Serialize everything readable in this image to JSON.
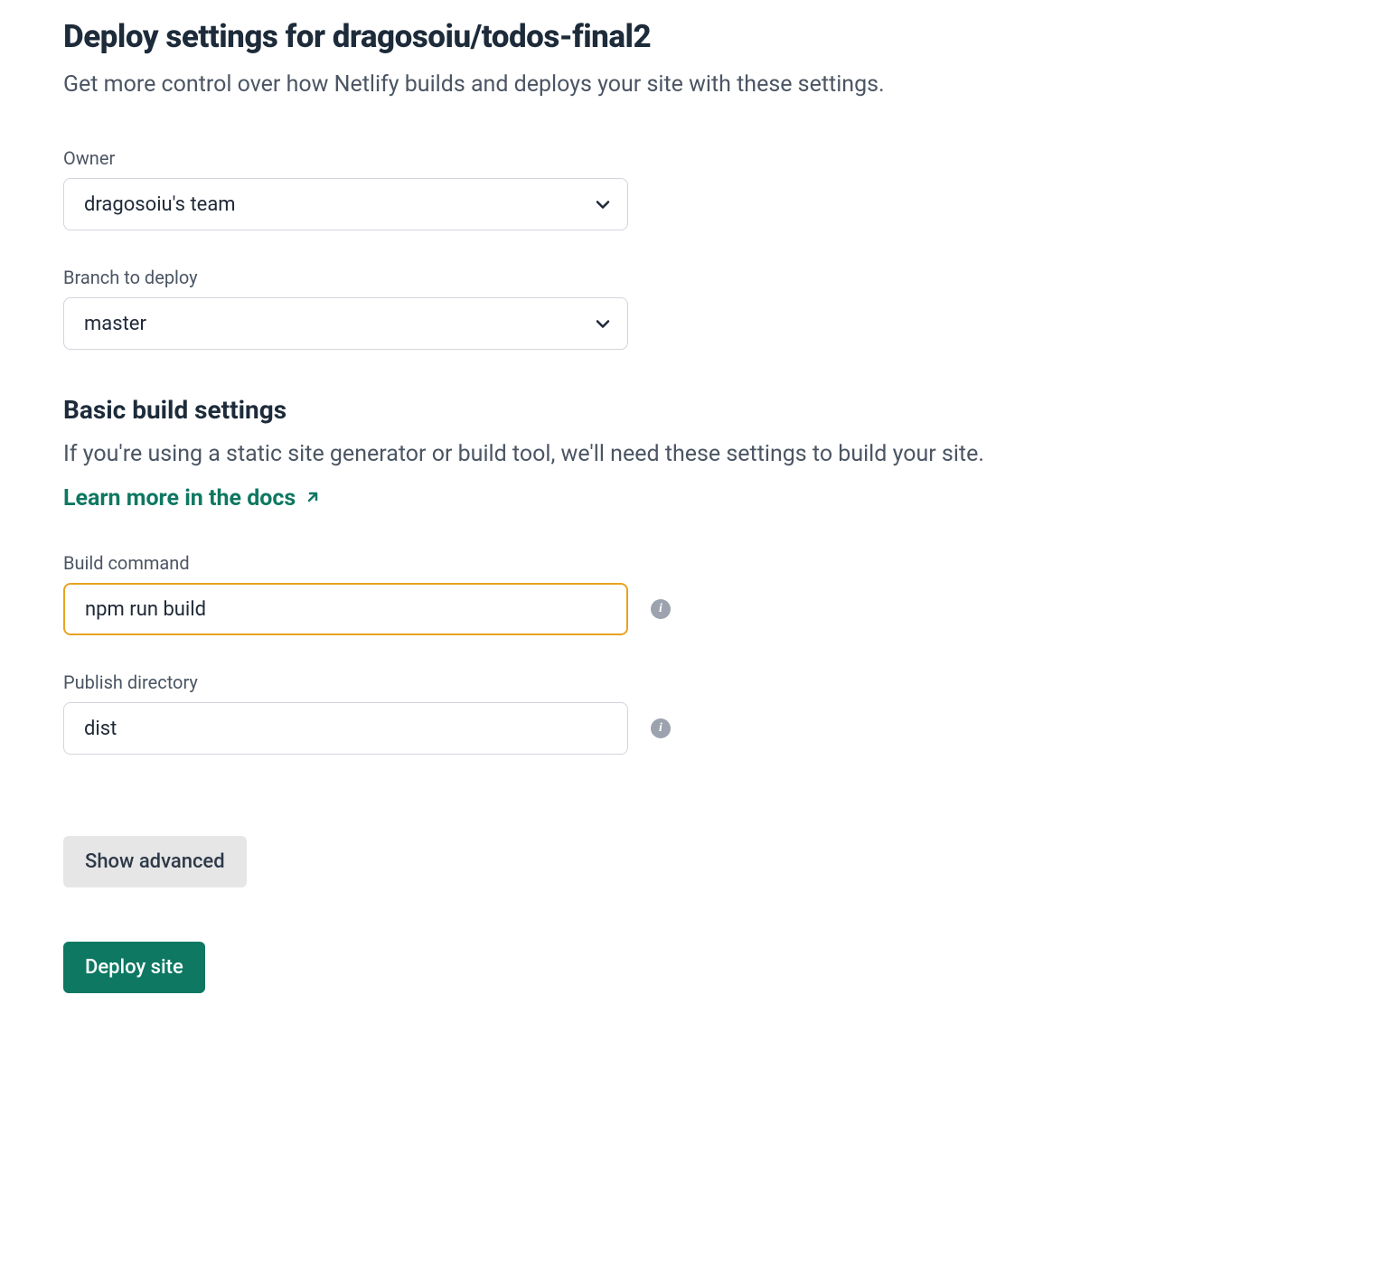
{
  "header": {
    "title": "Deploy settings for dragosoiu/todos-final2",
    "subtitle": "Get more control over how Netlify builds and deploys your site with these settings."
  },
  "owner": {
    "label": "Owner",
    "value": "dragosoiu's team"
  },
  "branch": {
    "label": "Branch to deploy",
    "value": "master"
  },
  "buildSection": {
    "title": "Basic build settings",
    "subtitle": "If you're using a static site generator or build tool, we'll need these settings to build your site.",
    "docsLink": "Learn more in the docs"
  },
  "buildCommand": {
    "label": "Build command",
    "value": "npm run build"
  },
  "publishDirectory": {
    "label": "Publish directory",
    "value": "dist"
  },
  "buttons": {
    "showAdvanced": "Show advanced",
    "deploy": "Deploy site"
  }
}
